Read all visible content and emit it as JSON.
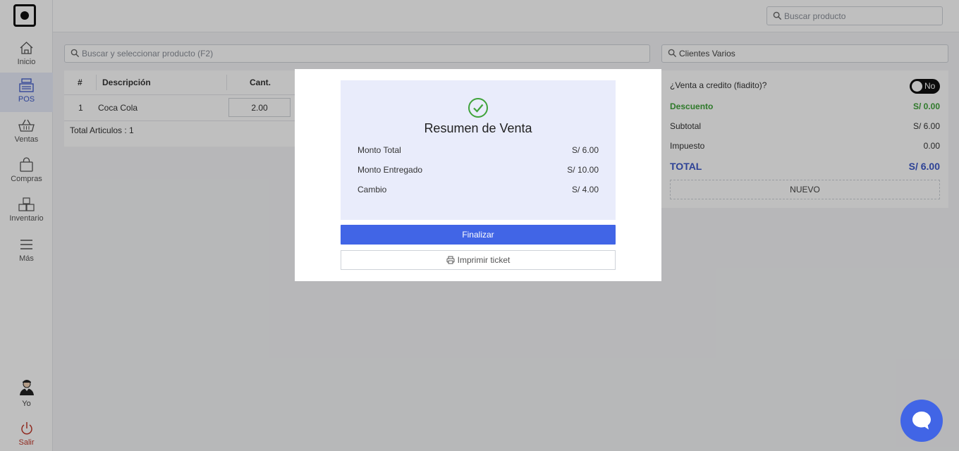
{
  "topbar": {
    "search_placeholder": "Buscar producto"
  },
  "sidebar": {
    "items": [
      {
        "label": "Inicio",
        "icon": "home-icon"
      },
      {
        "label": "POS",
        "icon": "cash-register-icon"
      },
      {
        "label": "Ventas",
        "icon": "basket-icon"
      },
      {
        "label": "Compras",
        "icon": "shopping-bag-icon"
      },
      {
        "label": "Inventario",
        "icon": "boxes-icon"
      },
      {
        "label": "Más",
        "icon": "menu-icon"
      }
    ],
    "user_label": "Yo",
    "logout_label": "Salir"
  },
  "main": {
    "product_search_placeholder": "Buscar y seleccionar producto (F2)",
    "client_search_value": "Clientes Varios",
    "table": {
      "columns": [
        "#",
        "Descripción",
        "Cant."
      ],
      "rows": [
        {
          "num": "1",
          "description": "Coca Cola",
          "qty": "2.00"
        }
      ],
      "total_items": "Total Articulos : 1"
    },
    "summary": {
      "credit_label": "¿Venta a credito (fiadito)?",
      "credit_toggle": "No",
      "discount_label": "Descuento",
      "discount_value": "S/ 0.00",
      "subtotal_label": "Subtotal",
      "subtotal_value": "S/ 6.00",
      "tax_label": "Impuesto",
      "tax_value": "0.00",
      "total_label": "TOTAL",
      "total_value": "S/ 6.00",
      "new_button": "NUEVO"
    }
  },
  "modal": {
    "title": "Resumen de Venta",
    "rows": [
      {
        "label": "Monto Total",
        "value": "S/ 6.00"
      },
      {
        "label": "Monto Entregado",
        "value": "S/ 10.00"
      },
      {
        "label": "Cambio",
        "value": "S/ 4.00"
      }
    ],
    "finalize_button": "Finalizar",
    "print_button": "Imprimir ticket"
  },
  "colors": {
    "primary": "#4165e6",
    "success": "#3fa33a",
    "total": "#3c59c9"
  }
}
